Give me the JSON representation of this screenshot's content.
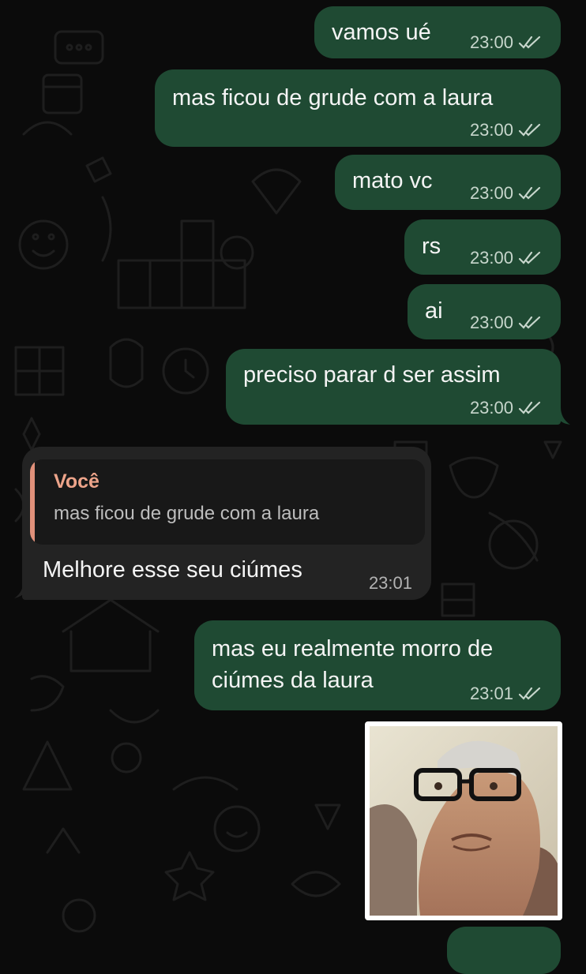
{
  "messages": [
    {
      "text": "vamos ué",
      "time": "23:00",
      "direction": "out",
      "status": "read"
    },
    {
      "text": "mas ficou de grude com a laura",
      "time": "23:00",
      "direction": "out",
      "status": "read"
    },
    {
      "text": "mato vc",
      "time": "23:00",
      "direction": "out",
      "status": "read"
    },
    {
      "text": "rs",
      "time": "23:00",
      "direction": "out",
      "status": "read"
    },
    {
      "text": "ai",
      "time": "23:00",
      "direction": "out",
      "status": "read"
    },
    {
      "text": "preciso parar d ser assim",
      "time": "23:00",
      "direction": "out",
      "status": "read"
    },
    {
      "text": "Melhore esse seu ciúmes",
      "time": "23:01",
      "direction": "in",
      "reply_to": {
        "author": "Você",
        "text": "mas ficou de grude com a laura"
      }
    },
    {
      "text_lines": [
        "mas eu realmente morro de",
        "ciúmes da laura"
      ],
      "time": "23:01",
      "direction": "out",
      "status": "read"
    },
    {
      "type": "image",
      "image_description": "close-up photo of an older man with gray hair and black glasses looking upward",
      "direction": "out"
    }
  ],
  "colors": {
    "background": "#0b0b0b",
    "outgoing_bubble": "#1f4a33",
    "incoming_bubble": "#232323",
    "quote_accent": "#e0907a",
    "read_ticks": "#c7d6cc"
  }
}
